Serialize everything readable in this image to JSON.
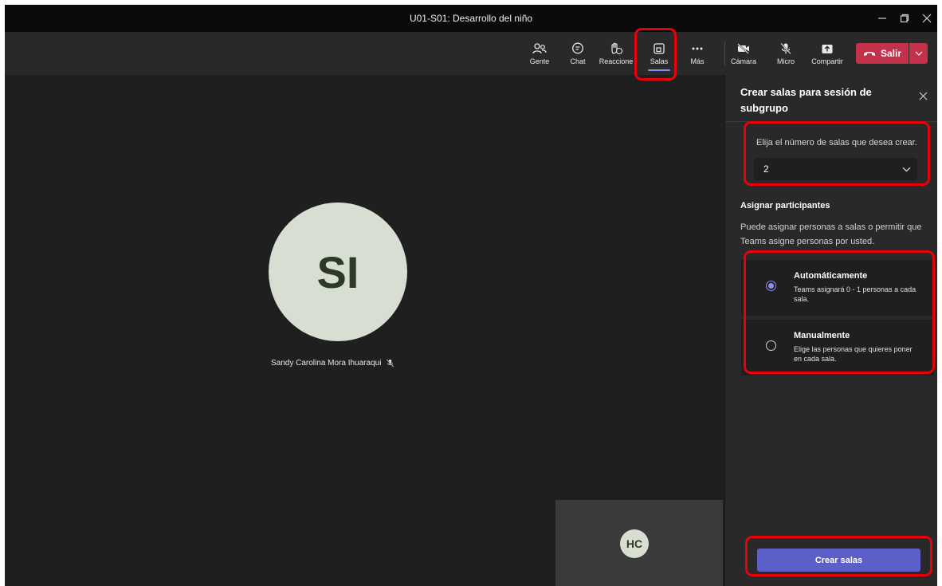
{
  "window": {
    "title": "U01-S01: Desarrollo del niño",
    "controls": {
      "minimize_icon": "minimize-icon",
      "maximize_icon": "maximize-icon",
      "close_icon": "close-icon"
    }
  },
  "toolbar": {
    "items": [
      {
        "label": "Gente",
        "icon": "people-icon"
      },
      {
        "label": "Chat",
        "icon": "chat-icon"
      },
      {
        "label": "Reaccione",
        "icon": "reactions-icon"
      },
      {
        "label": "Salas",
        "icon": "breakout-rooms-icon",
        "active": true
      },
      {
        "label": "Más",
        "icon": "more-icon"
      },
      {
        "label": "Cámara",
        "icon": "camera-off-icon"
      },
      {
        "label": "Micro",
        "icon": "mic-off-icon"
      },
      {
        "label": "Compartir",
        "icon": "share-icon"
      }
    ],
    "leave": {
      "label": "Salir",
      "icon": "hangup-icon"
    }
  },
  "stage": {
    "main_participant": {
      "initials": "SI",
      "name": "Sandy Carolina Mora Ihuaraqui",
      "muted": true
    },
    "self_tile": {
      "initials": "HC"
    }
  },
  "panel": {
    "title": "Crear salas para sesión de subgrupo",
    "rooms_count": {
      "label": "Elija el número de salas que desea crear.",
      "value": "2"
    },
    "assign": {
      "heading": "Asignar participantes",
      "description": "Puede asignar personas a salas o permitir que Teams asigne personas por usted.",
      "options": [
        {
          "title": "Automáticamente",
          "description": "Teams asignará 0 - 1 personas a cada sala.",
          "selected": true
        },
        {
          "title": "Manualmente",
          "description": "Elige las personas que quieres poner en cada sala.",
          "selected": false
        }
      ]
    },
    "create_button": "Crear salas"
  },
  "colors": {
    "accent": "#5b5fc7",
    "accent_light": "#8b8ff0",
    "leave": "#c4314b",
    "callout": "#e8000b",
    "avatar_bg": "#d8dfd2"
  }
}
